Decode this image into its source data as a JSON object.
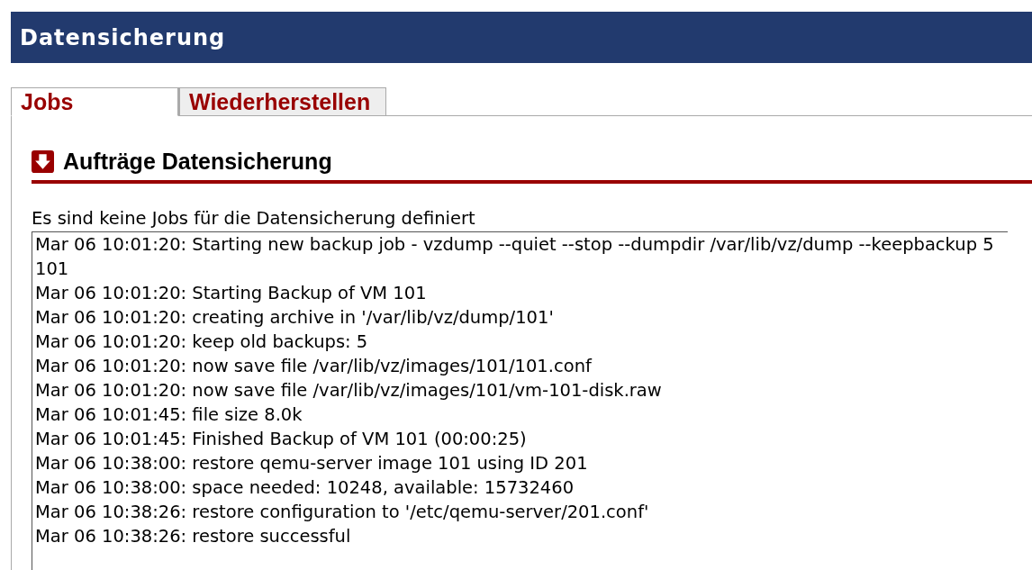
{
  "header": {
    "title": "Datensicherung"
  },
  "tabs": [
    {
      "label": "Jobs",
      "selected": true
    },
    {
      "label": "Wiederherstellen",
      "selected": false
    }
  ],
  "section": {
    "title": "Aufträge Datensicherung"
  },
  "message": "Es sind keine Jobs für die Datensicherung definiert",
  "log": [
    "Mar 06 10:01:20: Starting new backup job - vzdump --quiet --stop --dumpdir /var/lib/vz/dump --keepbackup 5 101",
    "Mar 06 10:01:20: Starting Backup of VM 101",
    "Mar 06 10:01:20: creating archive in '/var/lib/vz/dump/101'",
    "Mar 06 10:01:20: keep old backups: 5",
    "Mar 06 10:01:20: now save file /var/lib/vz/images/101/101.conf",
    "Mar 06 10:01:20: now save file /var/lib/vz/images/101/vm-101-disk.raw",
    "Mar 06 10:01:45: file size 8.0k",
    "Mar 06 10:01:45: Finished Backup of VM 101 (00:00:25)",
    "Mar 06 10:38:00: restore qemu-server image 101 using ID 201",
    "Mar 06 10:38:00: space needed: 10248, available: 15732460",
    "Mar 06 10:38:26: restore configuration to '/etc/qemu-server/201.conf'",
    "Mar 06 10:38:26: restore successful"
  ]
}
